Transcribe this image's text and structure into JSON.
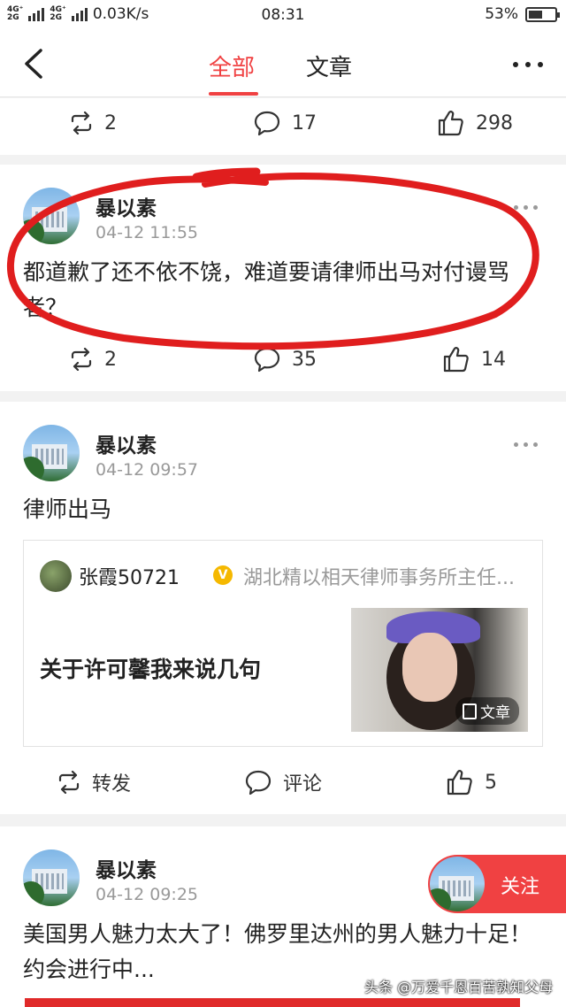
{
  "status_bar": {
    "network_1": "4G⁺",
    "network_2": "4G⁺ 2G",
    "network_3": "2G",
    "speed": "0.03K/s",
    "time": "08:31",
    "battery_percent": "53%",
    "battery_level": 0.53
  },
  "nav": {
    "tab_all": "全部",
    "tab_articles": "文章",
    "active_tab": "全部"
  },
  "post0": {
    "reposts": "2",
    "comments": "17",
    "likes": "298"
  },
  "post1": {
    "author": "暴以素",
    "date": "04-12 11:55",
    "text": "都道歉了还不依不饶，难道要请律师出马对付谩骂者？",
    "reposts": "2",
    "comments": "35",
    "likes": "14"
  },
  "post2": {
    "author": "暴以素",
    "date": "04-12 09:57",
    "text": "律师出马",
    "quote": {
      "author": "张霞50721",
      "verified_mark": "V",
      "description": "湖北精以相天律师事务所主任...",
      "title": "关于许可馨我来说几句",
      "tag": "文章"
    },
    "repost_label": "转发",
    "comment_label": "评论",
    "likes": "5"
  },
  "post3": {
    "author": "暴以素",
    "date": "04-12 09:25",
    "text": "美国男人魅力太大了！佛罗里达州的男人魅力十足！约会进行中..."
  },
  "follow_button": {
    "label": "关注"
  },
  "watermark": "头条 @万爱千恩百苦孰知父母",
  "colors": {
    "accent": "#f04142",
    "annotation": "#e01e1e"
  }
}
